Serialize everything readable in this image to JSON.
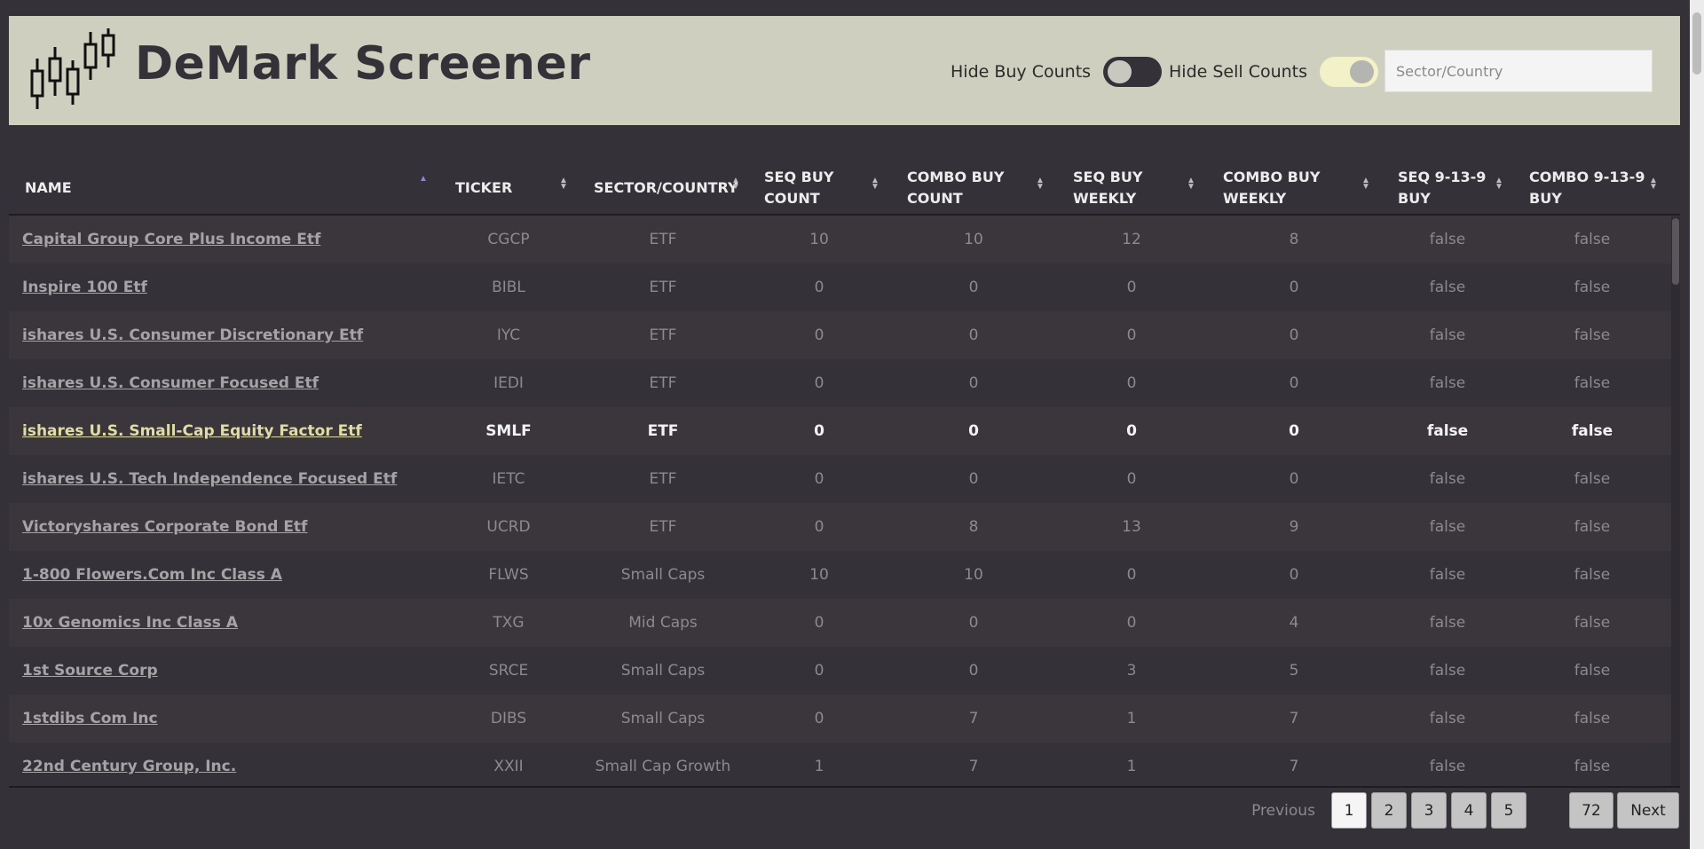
{
  "header": {
    "title": "DeMark Screener",
    "hide_buy_label": "Hide Buy Counts",
    "hide_buy_on": false,
    "hide_sell_label": "Hide Sell Counts",
    "hide_sell_on": true,
    "sector_placeholder": "Sector/Country"
  },
  "table": {
    "columns": [
      {
        "label": "NAME",
        "sort": "asc"
      },
      {
        "label": "TICKER",
        "sort": "none"
      },
      {
        "label": "SECTOR/COUNTRY",
        "sort": "none"
      },
      {
        "label": "SEQ BUY COUNT",
        "sort": "none"
      },
      {
        "label": "COMBO BUY COUNT",
        "sort": "none"
      },
      {
        "label": "SEQ BUY WEEKLY",
        "sort": "none"
      },
      {
        "label": "COMBO BUY WEEKLY",
        "sort": "none"
      },
      {
        "label": "SEQ 9-13-9 BUY",
        "sort": "none"
      },
      {
        "label": "COMBO 9-13-9 BUY",
        "sort": "none"
      }
    ],
    "rows": [
      [
        "Capital Group Core Plus Income Etf",
        "CGCP",
        "ETF",
        "10",
        "10",
        "12",
        "8",
        "false",
        "false"
      ],
      [
        "Inspire 100 Etf",
        "BIBL",
        "ETF",
        "0",
        "0",
        "0",
        "0",
        "false",
        "false"
      ],
      [
        "ishares U.S. Consumer Discretionary Etf",
        "IYC",
        "ETF",
        "0",
        "0",
        "0",
        "0",
        "false",
        "false"
      ],
      [
        "ishares U.S. Consumer Focused Etf",
        "IEDI",
        "ETF",
        "0",
        "0",
        "0",
        "0",
        "false",
        "false"
      ],
      [
        "ishares U.S. Small-Cap Equity Factor Etf",
        "SMLF",
        "ETF",
        "0",
        "0",
        "0",
        "0",
        "false",
        "false"
      ],
      [
        "ishares U.S. Tech Independence Focused Etf",
        "IETC",
        "ETF",
        "0",
        "0",
        "0",
        "0",
        "false",
        "false"
      ],
      [
        "Victoryshares Corporate Bond Etf",
        "UCRD",
        "ETF",
        "0",
        "8",
        "13",
        "9",
        "false",
        "false"
      ],
      [
        "1-800 Flowers.Com Inc Class A",
        "FLWS",
        "Small Caps",
        "10",
        "10",
        "0",
        "0",
        "false",
        "false"
      ],
      [
        "10x Genomics Inc Class A",
        "TXG",
        "Mid Caps",
        "0",
        "0",
        "0",
        "4",
        "false",
        "false"
      ],
      [
        "1st Source Corp",
        "SRCE",
        "Small Caps",
        "0",
        "0",
        "3",
        "5",
        "false",
        "false"
      ],
      [
        "1stdibs Com Inc",
        "DIBS",
        "Small Caps",
        "0",
        "7",
        "1",
        "7",
        "false",
        "false"
      ],
      [
        "22nd Century Group, Inc.",
        "XXII",
        "Small Cap Growth",
        "1",
        "7",
        "1",
        "7",
        "false",
        "false"
      ]
    ],
    "highlighted_row": 4
  },
  "pagination": {
    "previous": "Previous",
    "pages": [
      "1",
      "2",
      "3",
      "4",
      "5"
    ],
    "active": "1",
    "last": "72",
    "next": "Next"
  },
  "colors": {
    "background": "#353138",
    "header_bg": "#cfcfc0",
    "highlight_name": "#dfdca7"
  }
}
